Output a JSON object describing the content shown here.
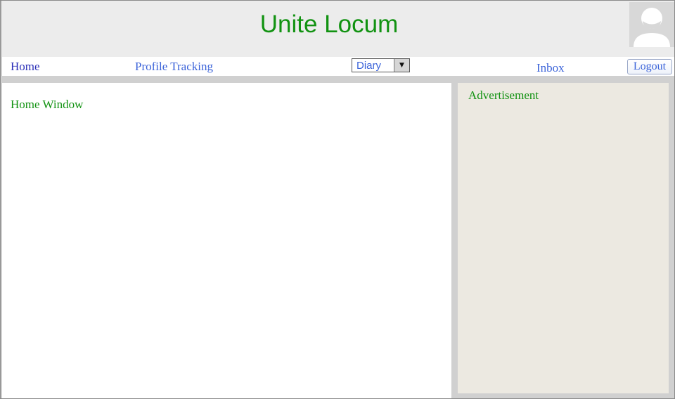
{
  "header": {
    "title": "Unite Locum",
    "avatar_icon": "user-avatar-icon"
  },
  "nav": {
    "home": "Home",
    "profile_tracking": "Profile Tracking",
    "diary": {
      "selected": "Diary",
      "arrow_icon": "dropdown-arrow-icon"
    },
    "inbox": "Inbox",
    "logout": "Logout"
  },
  "main": {
    "title": "Home Window"
  },
  "sidebar": {
    "title": "Advertisement"
  },
  "colors": {
    "title_green": "#119211",
    "link_blue": "#3b63d9",
    "home_link_blue": "#2b2fb8",
    "header_bg": "#ececec",
    "sidebar_bg": "#ece9e1",
    "frame_gray": "#d0d0d0"
  }
}
